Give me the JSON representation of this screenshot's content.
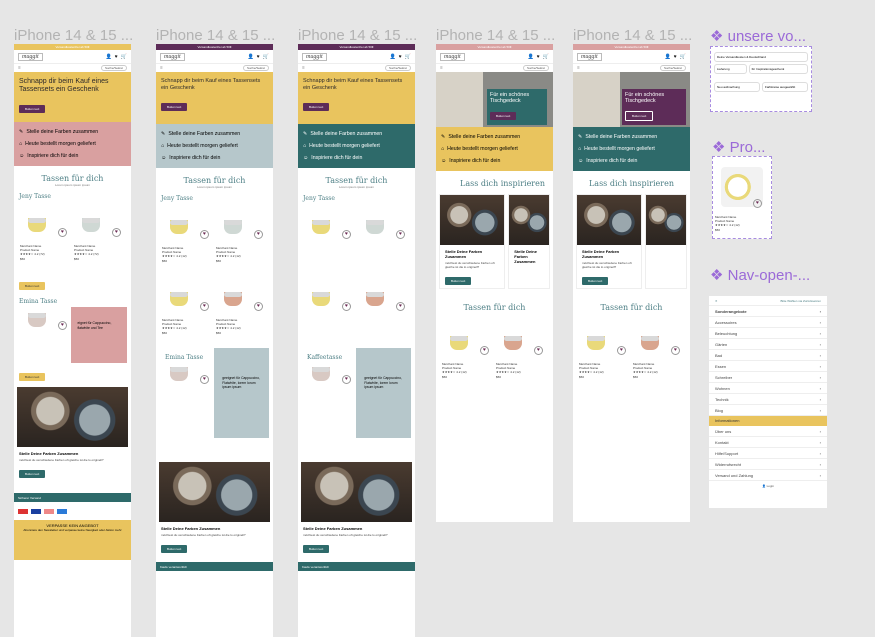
{
  "frames": [
    {
      "label": "iPhone 14 & 15 ...",
      "banner": "Versandkostenfrei ab 50€",
      "logo": "muggit",
      "search": "Suche/Sekret",
      "hero_title": "Schnapp dir beim Kauf eines Tassensets ein Geschenk",
      "hero_button": "Button text",
      "features": [
        "Stelle deine Farben zusammen",
        "Heute bestellt morgen geliefert",
        "Inspiriere dich für dein"
      ],
      "section_title": "Tassen für dich",
      "section_sub": "Lorem ipsum ipsum ipsum",
      "category": "Jeny Tasse",
      "category2": "Emina Tasse",
      "side_text": "eignet für Cappuccino, flatwhite und Tee",
      "products": [
        {
          "merchant": "Merchant Name",
          "name": "Product Name",
          "rating": "★★★★☆ 4.2 (72)",
          "price": "$50"
        },
        {
          "merchant": "Merchant Name",
          "name": "Product Name",
          "rating": "★★★★☆ 4.2 (72)",
          "price": "$50"
        }
      ],
      "photo_title": "Stelle Deine Farben Zusammen",
      "photo_text": "möchtest du verschiedene Farben oft gleiche ist die lo originell?",
      "button": "Button text",
      "foot_items": [
        "Sicherer Versand"
      ],
      "footer_title": "VERPASSE KEIN ANGEBOT",
      "footer_text": "Abonniere den Newsletter und verpasse keine Neuigkeit oder Aktion mehr"
    },
    {
      "label": "iPhone 14 & 15 ...",
      "banner": "Versandkostenfrei ab 50€",
      "logo": "muggit",
      "search": "Suche/Sekret",
      "hero_title": "Schnapp dir beim Kauf eines Tassensets ein Geschenk",
      "hero_button": "Button text",
      "features": [
        "Stelle deine Farben zusammen",
        "Heute bestellt morgen geliefert",
        "Inspiriere dich für dein"
      ],
      "section_title": "Tassen für dich",
      "section_sub": "Lorem ipsum ipsum ipsum",
      "category": "Jeny Tasse",
      "category2": "Emina Tasse",
      "side_text": "geeignet für Cappuccino, Flatwhite, lorem lorum ipsum ipsum",
      "merchant": "Merchant Name",
      "pname": "Product Name",
      "rating": "★★★★☆ 4.2 (12)",
      "price": "$50",
      "photo_title": "Stelle Deine Farben Zusammen",
      "photo_text": "möchtest du verschiedene Farben oft gleiche ist die lo originell?",
      "button": "Button text",
      "foot_text": "Kaufe verantwortlich"
    },
    {
      "label": "iPhone 14 & 15 ...",
      "category": "Jeny Tasse",
      "category2": "Kaffeetasse"
    },
    {
      "label": "iPhone 14 & 15 ...",
      "hero_title": "Für ein schönes Tischgedeck",
      "section1": "Lass dich inspirieren",
      "card_title": "Stelle Deine Farben Zusammen",
      "card_text": "möchtest du verschiedene Farben oft gleiche ist die lo originell?",
      "section2": "Tassen für dich"
    },
    {
      "label": "iPhone 14 & 15 ..."
    }
  ],
  "right": {
    "title1": "unsere vo...",
    "title2": "Pro...",
    "title3": "Nav-open-...",
    "filters": [
      "Deine Versandkosten & Deutschland",
      "Lieferung",
      "für Inspirationsgeschenk",
      "Neu aufmachung",
      "Farbkreise ausgewählt"
    ],
    "nav_top": "Bitte Wählen via Zurücksetzen",
    "nav_items": [
      "Sonderangebote",
      "Accessoires",
      "Beleuchtung",
      "Gärten",
      "Bad",
      "Essen",
      "Schreiber",
      "Wohnen",
      "Technik",
      "Blog"
    ],
    "nav_section": "Informationen",
    "info_items": [
      "Über uns",
      "Kontakt",
      "Hilfe/Support",
      "Widerrufsrecht",
      "Versand und Zahlung"
    ],
    "login": "Login"
  },
  "colors": {
    "yellow": "#e9c45e",
    "pink": "#d9a0a0",
    "teal": "#2e6a6a",
    "plum": "#5d2c58",
    "blue_grey": "#b6c7cb"
  }
}
